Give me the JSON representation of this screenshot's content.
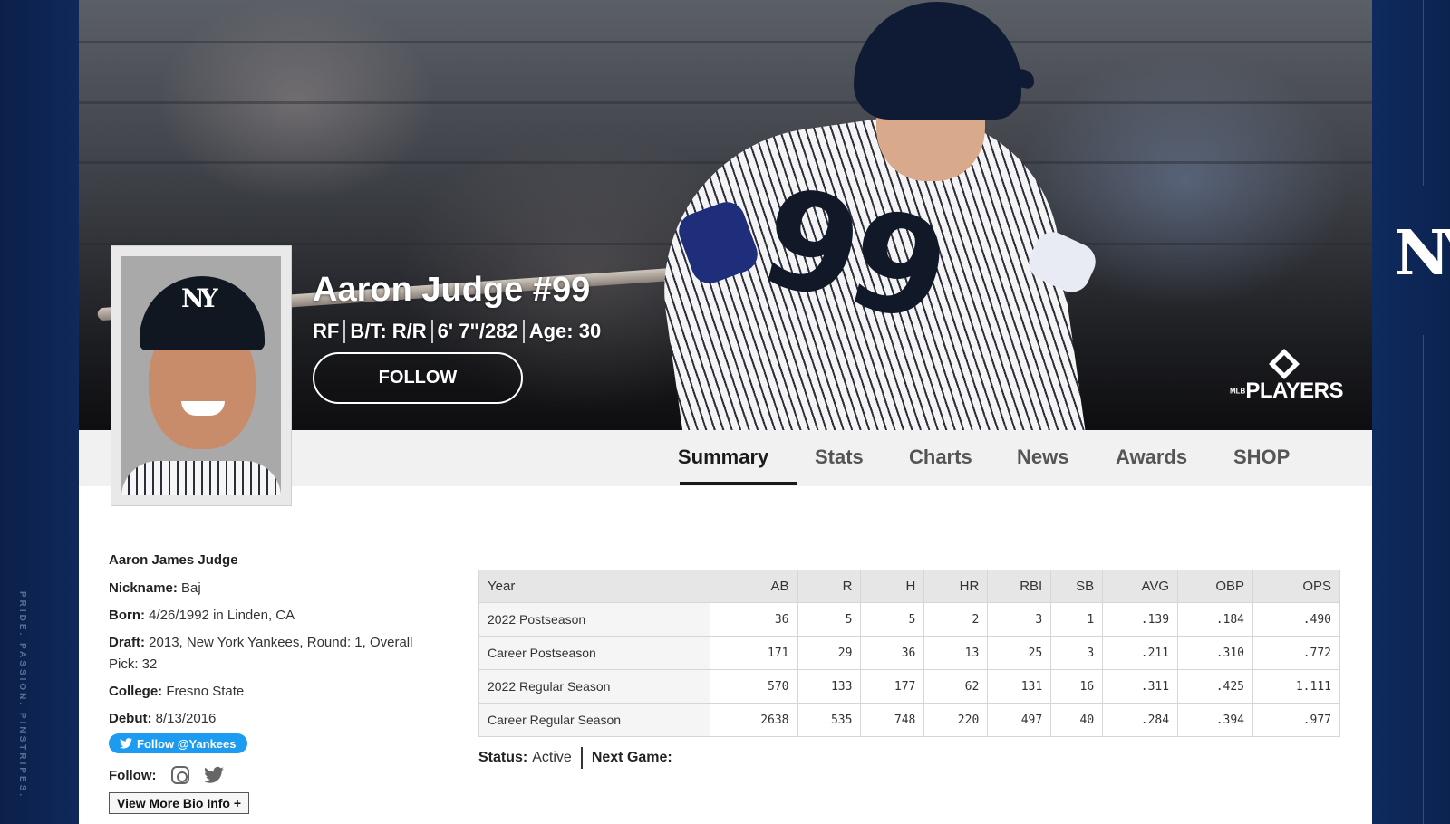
{
  "side": {
    "tagline": "PRIDE. PASSION. PINSTRIPES."
  },
  "hero": {
    "jersey_number": "99",
    "brand_logo": {
      "small": "MLB",
      "big": "PLAYERS"
    }
  },
  "player": {
    "name_line": "Aaron Judge #99",
    "position": "RF",
    "bats_throws": "B/T: R/R",
    "height_weight": "6' 7\"/282",
    "age": "Age: 30",
    "follow_label": "FOLLOW"
  },
  "tabs": [
    {
      "label": "Summary",
      "active": true
    },
    {
      "label": "Stats"
    },
    {
      "label": "Charts"
    },
    {
      "label": "News"
    },
    {
      "label": "Awards"
    },
    {
      "label": "SHOP"
    }
  ],
  "bio": {
    "full_name": "Aaron James Judge",
    "nickname_label": "Nickname:",
    "nickname": "Baj",
    "born_label": "Born:",
    "born": "4/26/1992 in Linden, CA",
    "draft_label": "Draft:",
    "draft": "2013, New York Yankees, Round: 1, Overall Pick: 32",
    "college_label": "College:",
    "college": "Fresno State",
    "debut_label": "Debut:",
    "debut": "8/13/2016",
    "twitter_button": "Follow @Yankees",
    "follow_label": "Follow:",
    "more_button": "View More Bio Info +"
  },
  "stats": {
    "headers": [
      "Year",
      "AB",
      "R",
      "H",
      "HR",
      "RBI",
      "SB",
      "AVG",
      "OBP",
      "OPS"
    ],
    "rows": [
      [
        "2022 Postseason",
        "36",
        "5",
        "5",
        "2",
        "3",
        "1",
        ".139",
        ".184",
        ".490"
      ],
      [
        "Career Postseason",
        "171",
        "29",
        "36",
        "13",
        "25",
        "3",
        ".211",
        ".310",
        ".772"
      ],
      [
        "2022 Regular Season",
        "570",
        "133",
        "177",
        "62",
        "131",
        "16",
        ".311",
        ".425",
        "1.111"
      ],
      [
        "Career Regular Season",
        "2638",
        "535",
        "748",
        "220",
        "497",
        "40",
        ".284",
        ".394",
        ".977"
      ]
    ]
  },
  "status": {
    "status_label": "Status:",
    "status_value": "Active",
    "next_game_label": "Next Game:",
    "next_game_value": ""
  },
  "colors": {
    "navy": "#0c2350",
    "accent": "#1d9bf0",
    "tab_active": "#1a1a1a"
  },
  "icons": [
    "instagram-icon",
    "twitter-icon",
    "twitter-bird-icon",
    "ny-logo",
    "mlb-players-logo"
  ]
}
